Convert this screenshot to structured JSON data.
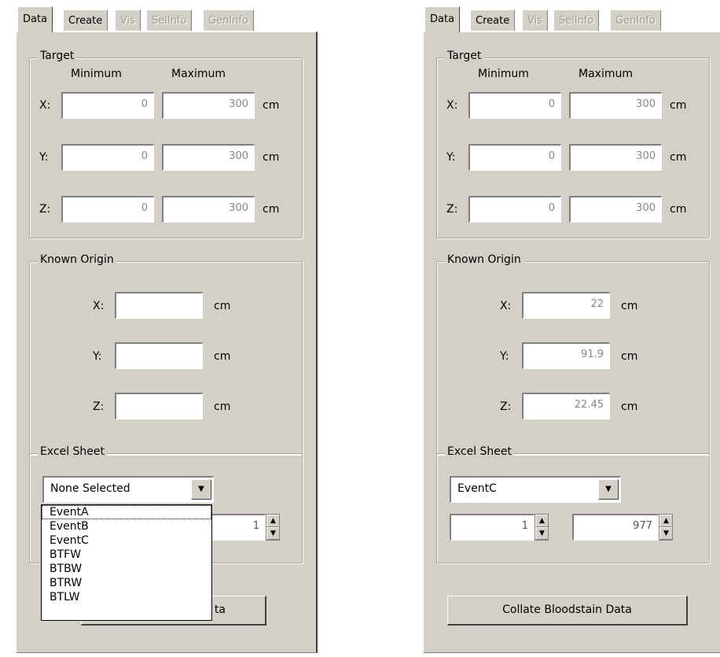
{
  "tabs": [
    "Data",
    "Create",
    "Vis",
    "SelInfo",
    "GenInfo"
  ],
  "target": {
    "title": "Target",
    "minimum_header": "Minimum",
    "maximum_header": "Maximum",
    "unit": "cm",
    "rows": [
      {
        "axis": "X:",
        "min": "0",
        "max": "300"
      },
      {
        "axis": "Y:",
        "min": "0",
        "max": "300"
      },
      {
        "axis": "Z:",
        "min": "0",
        "max": "300"
      }
    ]
  },
  "known_origin": {
    "title": "Known Origin",
    "unit": "cm",
    "axes": [
      "X:",
      "Y:",
      "Z:"
    ]
  },
  "excel_sheet": {
    "title": "Excel Sheet"
  },
  "left": {
    "origin_values": [
      "",
      "",
      ""
    ],
    "combo_value": "None Selected",
    "dropdown_options": [
      "EventA",
      "EventB",
      "EventC",
      "BTFW",
      "BTBW",
      "BTRW",
      "BTLW"
    ],
    "spin2_value": "1",
    "button_visible_text": "ta"
  },
  "right": {
    "origin_values": [
      "22",
      "91.9",
      "22.45"
    ],
    "combo_value": "EventC",
    "spin1_value": "1",
    "spin2_value": "977",
    "button_label": "Collate Bloodstain Data"
  }
}
